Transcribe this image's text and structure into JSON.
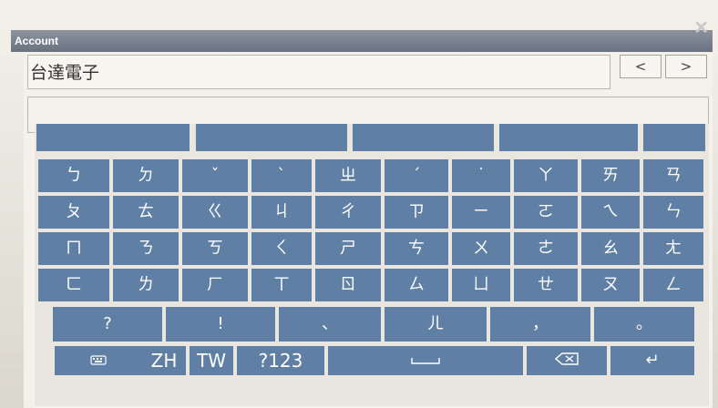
{
  "window": {
    "title": "Account",
    "close_glyph": "✕"
  },
  "account": {
    "value": "台達電子"
  },
  "nav": {
    "prev": "<",
    "next": ">"
  },
  "input": {
    "value": ""
  },
  "candidates": [
    "",
    "",
    "",
    "",
    ""
  ],
  "keys": {
    "row1": [
      "ㄅ",
      "ㄉ",
      "ˇ",
      "ˋ",
      "ㄓ",
      "ˊ",
      "˙",
      "ㄚ",
      "ㄞ",
      "ㄢ"
    ],
    "row2": [
      "ㄆ",
      "ㄊ",
      "ㄍ",
      "ㄐ",
      "ㄔ",
      "ㄗ",
      "ㄧ",
      "ㄛ",
      "ㄟ",
      "ㄣ"
    ],
    "row3": [
      "ㄇ",
      "ㄋ",
      "ㄎ",
      "ㄑ",
      "ㄕ",
      "ㄘ",
      "ㄨ",
      "ㄜ",
      "ㄠ",
      "ㄤ"
    ],
    "row4": [
      "ㄈ",
      "ㄌ",
      "ㄏ",
      "ㄒ",
      "ㄖ",
      "ㄙ",
      "ㄩ",
      "ㄝ",
      "ㄡ",
      "ㄥ"
    ],
    "row5": [
      "?",
      "!",
      "、",
      "ㄦ",
      "，",
      "。"
    ],
    "row6": {
      "keyboard_icon": "keyboard-icon",
      "lang_zh": "ZH",
      "lang_tw": "TW",
      "numeric": "?123",
      "space": "space-icon",
      "backspace": "backspace-icon",
      "enter": "↵"
    }
  },
  "colors": {
    "key_blue": "#5f7fa5",
    "frame_bg": "#f3f1ea",
    "title_bar": "#6a7280"
  }
}
